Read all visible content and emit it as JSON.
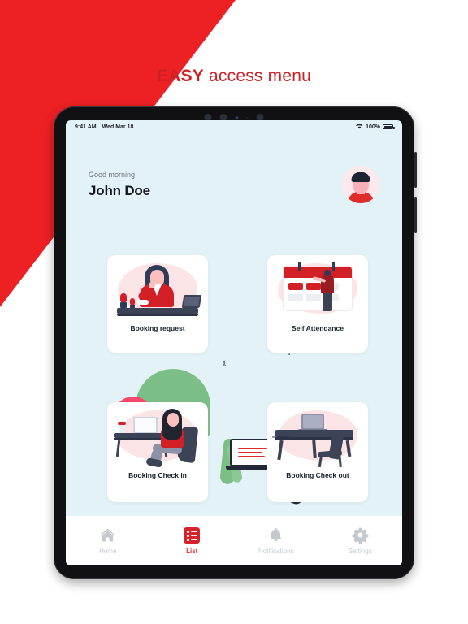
{
  "headline": {
    "strong": "EASY",
    "light": " access menu"
  },
  "device": {
    "status_bar": {
      "time": "9:41 AM",
      "date": "Wed Mar 18",
      "wifi_icon": "wifi-icon",
      "battery_percent": "100%",
      "battery_icon": "battery-full-icon"
    }
  },
  "app": {
    "greeting": {
      "subtitle": "Good morning",
      "name": "John Doe"
    },
    "avatar": {
      "icon": "user-avatar"
    },
    "cards": [
      {
        "label": "Booking request",
        "icon": "woman-at-desk-illustration"
      },
      {
        "label": "Self Attendance",
        "icon": "calendar-check-illustration"
      },
      {
        "label": "Booking Check in",
        "icon": "woman-sitting-laptop-illustration"
      },
      {
        "label": "Booking Check out",
        "icon": "empty-desk-chair-illustration"
      }
    ],
    "tabs": [
      {
        "label": "Home",
        "icon": "home-icon",
        "active": false
      },
      {
        "label": "List",
        "icon": "list-icon",
        "active": true
      },
      {
        "label": "Notifications",
        "icon": "bell-icon",
        "active": false
      },
      {
        "label": "Settings",
        "icon": "gear-icon",
        "active": false
      }
    ]
  },
  "colors": {
    "brand_red": "#ed2024",
    "accent_red": "#d9212a",
    "screen_bg": "#e2f2f6",
    "card_bg": "#ffffff",
    "inactive_gray": "#c4c9cd"
  }
}
